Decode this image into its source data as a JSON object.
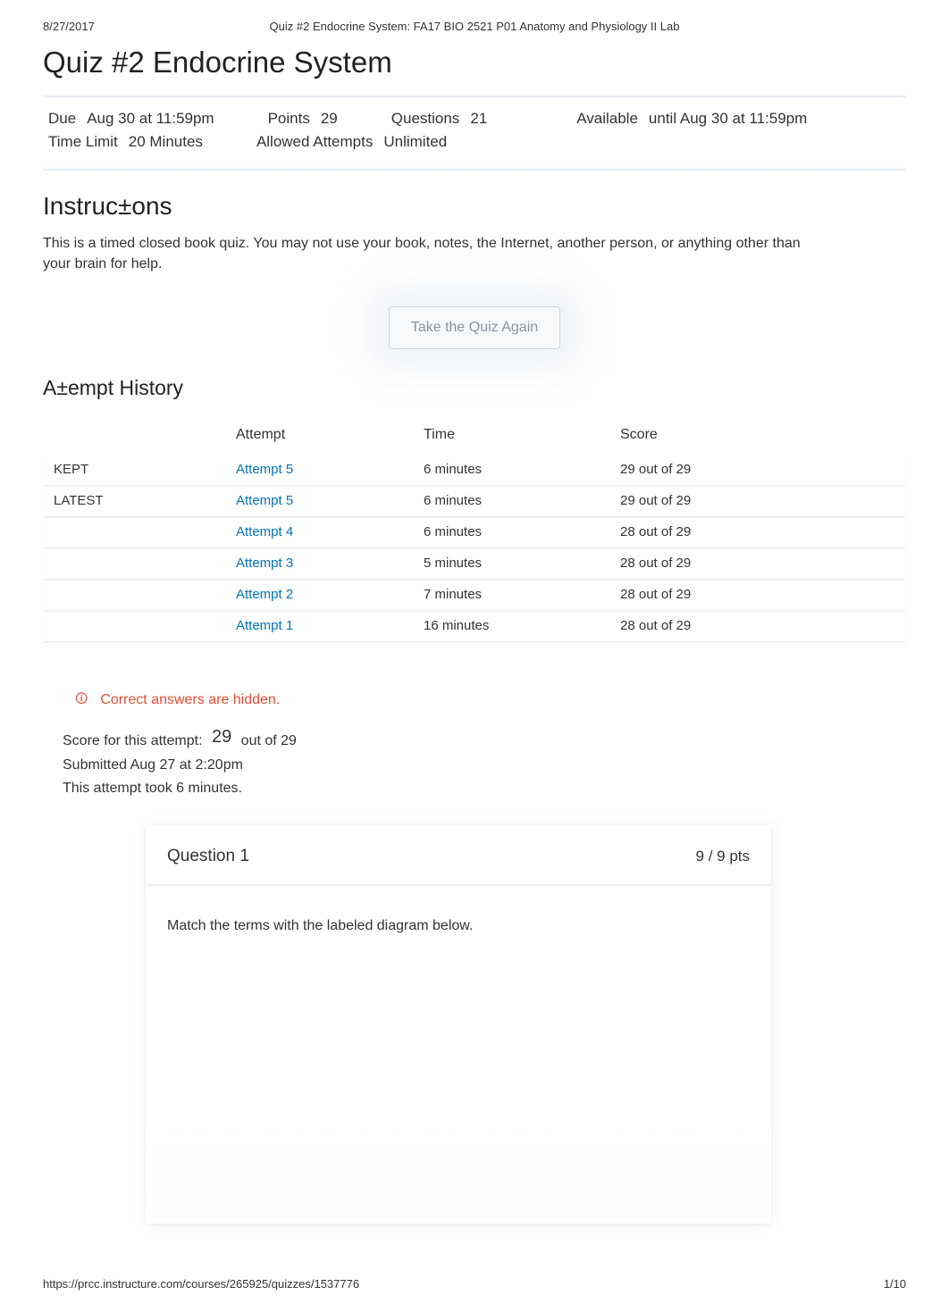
{
  "header": {
    "date": "8/27/2017",
    "title": "Quiz #2 Endocrine System: FA17 BIO 2521 P01 Anatomy and Physiology II Lab"
  },
  "quiz": {
    "title": "Quiz #2 Endocrine System",
    "meta": {
      "due_label": "Due",
      "due_value": "Aug 30 at 11:59pm",
      "points_label": "Points",
      "points_value": "29",
      "questions_label": "Questions",
      "questions_value": "21",
      "available_label": "Available",
      "available_value": "until Aug 30 at 11:59pm",
      "time_limit_label": "Time Limit",
      "time_limit_value": "20 Minutes",
      "allowed_attempts_label": "Allowed Attempts",
      "allowed_attempts_value": "Unlimited"
    }
  },
  "instructions": {
    "heading": "Instruc±ons",
    "text": "This is a timed closed book quiz. You may not use your book, notes, the Internet, another person, or anything other than your brain for help."
  },
  "take_again_label": "Take the Quiz Again",
  "attempt_history": {
    "heading": "A±empt History",
    "columns": {
      "attempt": "Attempt",
      "time": "Time",
      "score": "Score"
    },
    "rows": [
      {
        "tag": "KEPT",
        "attempt": "Attempt 5",
        "time": "6 minutes",
        "score": "29 out of 29"
      },
      {
        "tag": "LATEST",
        "attempt": "Attempt 5",
        "time": "6 minutes",
        "score": "29 out of 29"
      },
      {
        "tag": "",
        "attempt": "Attempt 4",
        "time": "6 minutes",
        "score": "28 out of 29"
      },
      {
        "tag": "",
        "attempt": "Attempt 3",
        "time": "5 minutes",
        "score": "28 out of 29"
      },
      {
        "tag": "",
        "attempt": "Attempt 2",
        "time": "7 minutes",
        "score": "28 out of 29"
      },
      {
        "tag": "",
        "attempt": "Attempt 1",
        "time": "16 minutes",
        "score": "28 out of 29"
      }
    ]
  },
  "banner": {
    "text": "Correct answers are hidden."
  },
  "score_info": {
    "score_prefix": "Score for this attempt:",
    "score_value": "29",
    "score_suffix": "out of 29",
    "submitted": "Submitted Aug 27 at 2:20pm",
    "duration": "This attempt took 6 minutes."
  },
  "question": {
    "label": "Question 1",
    "pts": "9 / 9 pts",
    "prompt": "Match the terms with the labeled diagram below."
  },
  "footer": {
    "url": "https://prcc.instructure.com/courses/265925/quizzes/1537776",
    "page": "1/10"
  }
}
